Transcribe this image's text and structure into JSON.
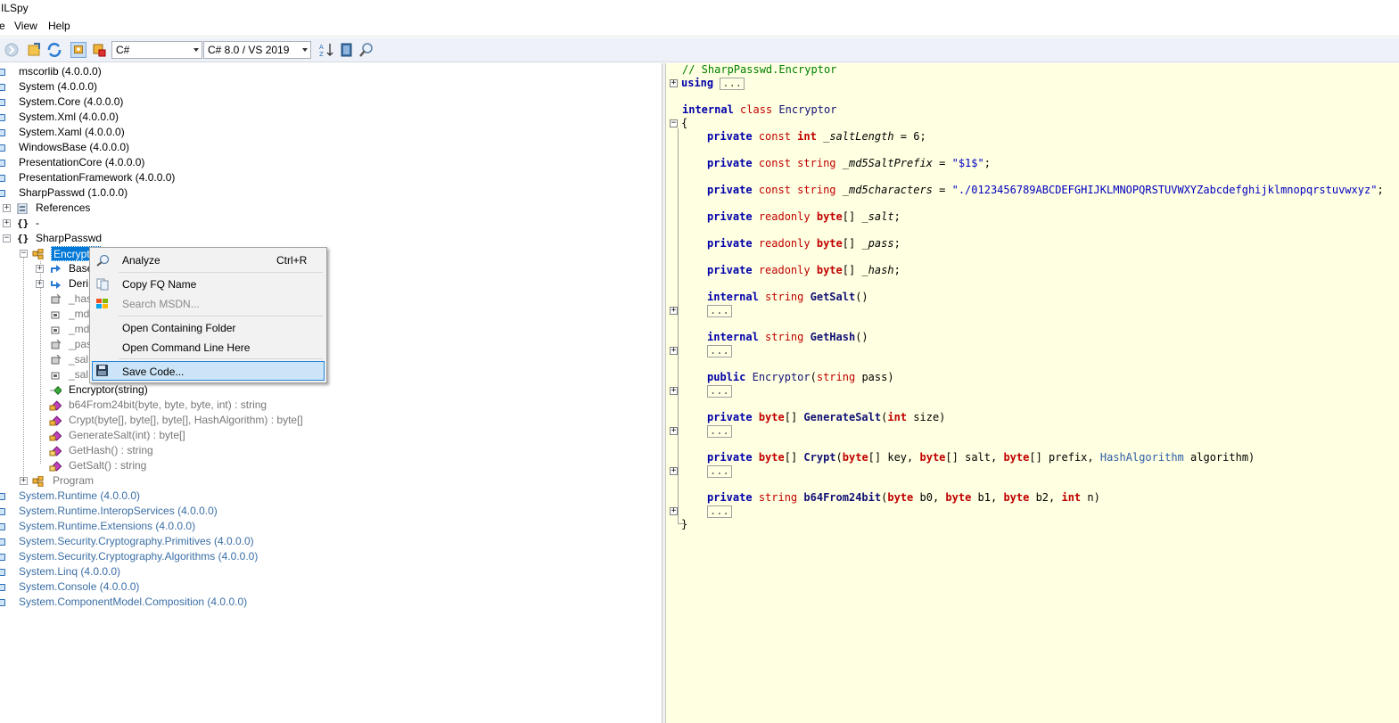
{
  "window": {
    "title": "ILSpy"
  },
  "menu": {
    "items": [
      "e",
      "View",
      "Help"
    ]
  },
  "toolbar": {
    "language": "C#",
    "language_version": "C# 8.0 / VS 2019"
  },
  "tree": {
    "assemblies_top": [
      {
        "name": "mscorlib (4.0.0.0)"
      },
      {
        "name": "System (4.0.0.0)"
      },
      {
        "name": "System.Core (4.0.0.0)"
      },
      {
        "name": "System.Xml (4.0.0.0)"
      },
      {
        "name": "System.Xaml (4.0.0.0)"
      },
      {
        "name": "WindowsBase (4.0.0.0)"
      },
      {
        "name": "PresentationCore (4.0.0.0)"
      },
      {
        "name": "PresentationFramework (4.0.0.0)"
      },
      {
        "name": "SharpPasswd (1.0.0.0)"
      }
    ],
    "references": "References",
    "ns_dash": "-",
    "ns_sharp": "SharpPasswd",
    "selected_class": "Encryptor",
    "base": "Base",
    "derived": "Deri",
    "fields": [
      "_has",
      "_md",
      "_md",
      "_pas",
      "_sal",
      "_sal"
    ],
    "members": [
      {
        "text": "Encryptor(string)",
        "dim": false
      },
      {
        "text": "b64From24bit(byte, byte, byte, int) : string",
        "dim": true
      },
      {
        "text": "Crypt(byte[], byte[], byte[], HashAlgorithm) : byte[]",
        "dim": true
      },
      {
        "text": "GenerateSalt(int) : byte[]",
        "dim": true
      },
      {
        "text": "GetHash() : string",
        "dim": true
      },
      {
        "text": "GetSalt() : string",
        "dim": true
      }
    ],
    "program": "Program",
    "assemblies_bottom": [
      {
        "name": "System.Runtime (4.0.0.0)"
      },
      {
        "name": "System.Runtime.InteropServices (4.0.0.0)"
      },
      {
        "name": "System.Runtime.Extensions (4.0.0.0)"
      },
      {
        "name": "System.Security.Cryptography.Primitives (4.0.0.0)"
      },
      {
        "name": "System.Security.Cryptography.Algorithms (4.0.0.0)"
      },
      {
        "name": "System.Linq (4.0.0.0)"
      },
      {
        "name": "System.Console (4.0.0.0)"
      },
      {
        "name": "System.ComponentModel.Composition (4.0.0.0)"
      }
    ]
  },
  "context_menu": {
    "analyze": "Analyze",
    "analyze_shortcut": "Ctrl+R",
    "copy_fq": "Copy FQ Name",
    "search_msdn": "Search MSDN...",
    "open_folder": "Open Containing Folder",
    "open_cmd": "Open Command Line Here",
    "save_code": "Save Code..."
  },
  "code": {
    "comment": "// SharpPasswd.Encryptor",
    "using": "using",
    "ellipsis": "...",
    "class_internal": "internal",
    "class_kw": "class",
    "class_name": "Encryptor",
    "open_brace": "{",
    "close_brace": "}",
    "salt_length_name": "_saltLength",
    "salt_length_value": "6",
    "md5_prefix_name": "_md5SaltPrefix",
    "md5_prefix_value": "\"$1$\"",
    "md5_chars_name": "_md5characters",
    "md5_chars_value": "\"./0123456789ABCDEFGHIJKLMNOPQRSTUVWXYZabcdefghijklmnopqrstuvwxyz\"",
    "salt_name": "_salt",
    "pass_name": "_pass",
    "hash_name": "_hash",
    "get_salt": "GetSalt",
    "get_hash": "GetHash",
    "ctor_name": "Encryptor",
    "ctor_param": "pass",
    "generate_salt": "GenerateSalt",
    "generate_salt_param": "size",
    "crypt": "Crypt",
    "crypt_p1": "key",
    "crypt_p2": "salt",
    "crypt_p3": "prefix",
    "hash_algorithm": "HashAlgorithm",
    "crypt_p4": "algorithm",
    "b64": "b64From24bit",
    "b64_p1": "b0",
    "b64_p2": "b1",
    "b64_p3": "b2",
    "b64_p4": "n"
  },
  "colors": {
    "code_background": "#ffffe1",
    "selection": "#0078d7",
    "menu_highlight": "#cce4f7"
  }
}
